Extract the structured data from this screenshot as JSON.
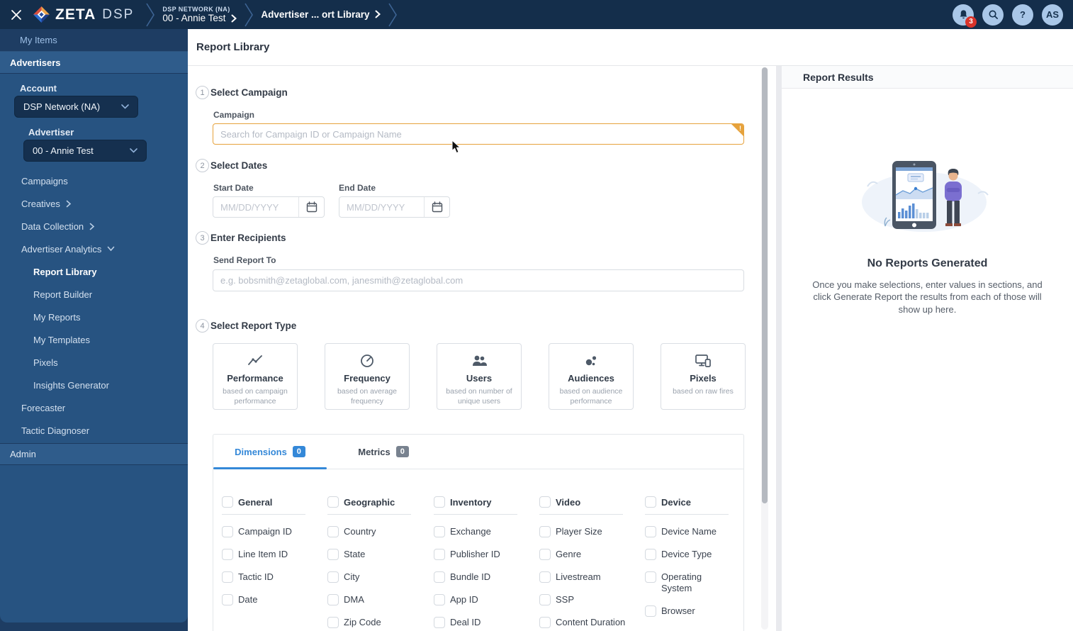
{
  "header": {
    "logo": {
      "brand": "ZETA",
      "suffix": "DSP"
    },
    "breadcrumb": [
      {
        "top": "DSP NETWORK (NA)",
        "label": "00 - Annie Test"
      },
      {
        "label": "Advertiser ... ort Library"
      }
    ],
    "notification_count": "3",
    "help_glyph": "?",
    "avatar_initials": "AS"
  },
  "sidebar": {
    "my_items": "My Items",
    "advertisers_header": "Advertisers",
    "account_label": "Account",
    "account_value": "DSP Network (NA)",
    "advertiser_label": "Advertiser",
    "advertiser_value": "00 - Annie Test",
    "nav_items": [
      {
        "label": "Campaigns",
        "chevron": null,
        "indent": 0,
        "active": false
      },
      {
        "label": "Creatives",
        "chevron": "right",
        "indent": 0,
        "active": false
      },
      {
        "label": "Data Collection",
        "chevron": "right",
        "indent": 0,
        "active": false
      },
      {
        "label": "Advertiser Analytics",
        "chevron": "down",
        "indent": 0,
        "active": false
      },
      {
        "label": "Report Library",
        "chevron": null,
        "indent": 1,
        "active": true
      },
      {
        "label": "Report Builder",
        "chevron": null,
        "indent": 1,
        "active": false
      },
      {
        "label": "My Reports",
        "chevron": null,
        "indent": 1,
        "active": false
      },
      {
        "label": "My Templates",
        "chevron": null,
        "indent": 1,
        "active": false
      },
      {
        "label": "Pixels",
        "chevron": null,
        "indent": 1,
        "active": false
      },
      {
        "label": "Insights Generator",
        "chevron": null,
        "indent": 1,
        "active": false
      },
      {
        "label": "Forecaster",
        "chevron": null,
        "indent": 0,
        "active": false
      },
      {
        "label": "Tactic Diagnoser",
        "chevron": null,
        "indent": 0,
        "active": false
      }
    ],
    "admin_label": "Admin"
  },
  "main": {
    "title": "Report Library",
    "campaign": {
      "number": "1",
      "title": "Select Campaign",
      "field_label": "Campaign",
      "placeholder": "Search for Campaign ID or Campaign Name",
      "warning_mark": "!"
    },
    "dates": {
      "number": "2",
      "title": "Select Dates",
      "start_label": "Start Date",
      "end_label": "End Date",
      "date_placeholder": "MM/DD/YYYY"
    },
    "recipients": {
      "number": "3",
      "title": "Enter Recipients",
      "field_label": "Send Report To",
      "placeholder": "e.g. bobsmith@zetaglobal.com, janesmith@zetaglobal.com"
    },
    "report_type": {
      "number": "4",
      "title": "Select Report Type",
      "cards": [
        {
          "icon": "trend-icon",
          "label": "Performance",
          "description": "based on campaign performance"
        },
        {
          "icon": "gauge-icon",
          "label": "Frequency",
          "description": "based on average frequency"
        },
        {
          "icon": "users-icon",
          "label": "Users",
          "description": "based on number of unique users"
        },
        {
          "icon": "audience-icon",
          "label": "Audiences",
          "description": "based on audience performance"
        },
        {
          "icon": "pixels-icon",
          "label": "Pixels",
          "description": "based on raw fires"
        }
      ]
    },
    "tabs": {
      "dimensions": {
        "label": "Dimensions",
        "count": "0"
      },
      "metrics": {
        "label": "Metrics",
        "count": "0"
      }
    },
    "dimension_groups": [
      {
        "label": "General",
        "items": [
          "Campaign ID",
          "Line Item ID",
          "Tactic ID",
          "Date"
        ]
      },
      {
        "label": "Geographic",
        "items": [
          "Country",
          "State",
          "City",
          "DMA",
          "Zip Code"
        ]
      },
      {
        "label": "Inventory",
        "items": [
          "Exchange",
          "Publisher ID",
          "Bundle ID",
          "App ID",
          "Deal ID"
        ]
      },
      {
        "label": "Video",
        "items": [
          "Player Size",
          "Genre",
          "Livestream",
          "SSP",
          "Content Duration"
        ]
      },
      {
        "label": "Device",
        "items": [
          "Device Name",
          "Device Type",
          "Operating System",
          "Browser"
        ]
      }
    ]
  },
  "results": {
    "title": "Report Results",
    "empty_title": "No Reports Generated",
    "empty_message": "Once you make selections, enter values in sections, and click Generate Report the results from each of those will show up here."
  },
  "colors": {
    "header_navy": "#142e4b",
    "sidebar_blue": "#275381",
    "accent_blue": "#3488d8",
    "warning_orange": "#e6a23c",
    "badge_red": "#d9342b"
  }
}
